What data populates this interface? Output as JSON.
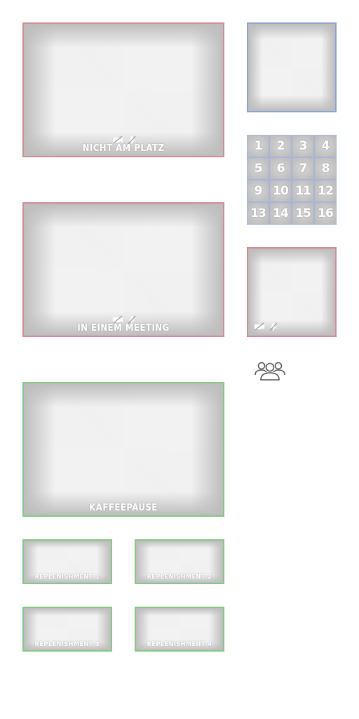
{
  "tiles": {
    "main1": {
      "label": "NICHT AM PLATZ",
      "border": "#d48a94"
    },
    "main2": {
      "label": "IN EINEM MEETING",
      "border": "#d48a94"
    },
    "main3": {
      "label": "KAFFEEPAUSE",
      "border": "#84c884"
    },
    "preview_top": {
      "border": "#8aa2d4"
    },
    "preview_bottom": {
      "border": "#d48a94"
    },
    "rep1": {
      "label": "REPLENISHMENT 1"
    },
    "rep2": {
      "label": "REPLENISHMENT 2"
    },
    "rep3": {
      "label": "REPLENISHMENT 3"
    },
    "rep4": {
      "label": "REPLENISHMENT 4"
    }
  },
  "grid": {
    "cells": [
      "1",
      "2",
      "3",
      "4",
      "5",
      "6",
      "7",
      "8",
      "9",
      "10",
      "11",
      "12",
      "13",
      "14",
      "15",
      "16"
    ]
  },
  "icons": {
    "camera_off": "camera-off-icon",
    "mic_off": "mic-off-icon",
    "people": "people-group-icon"
  }
}
